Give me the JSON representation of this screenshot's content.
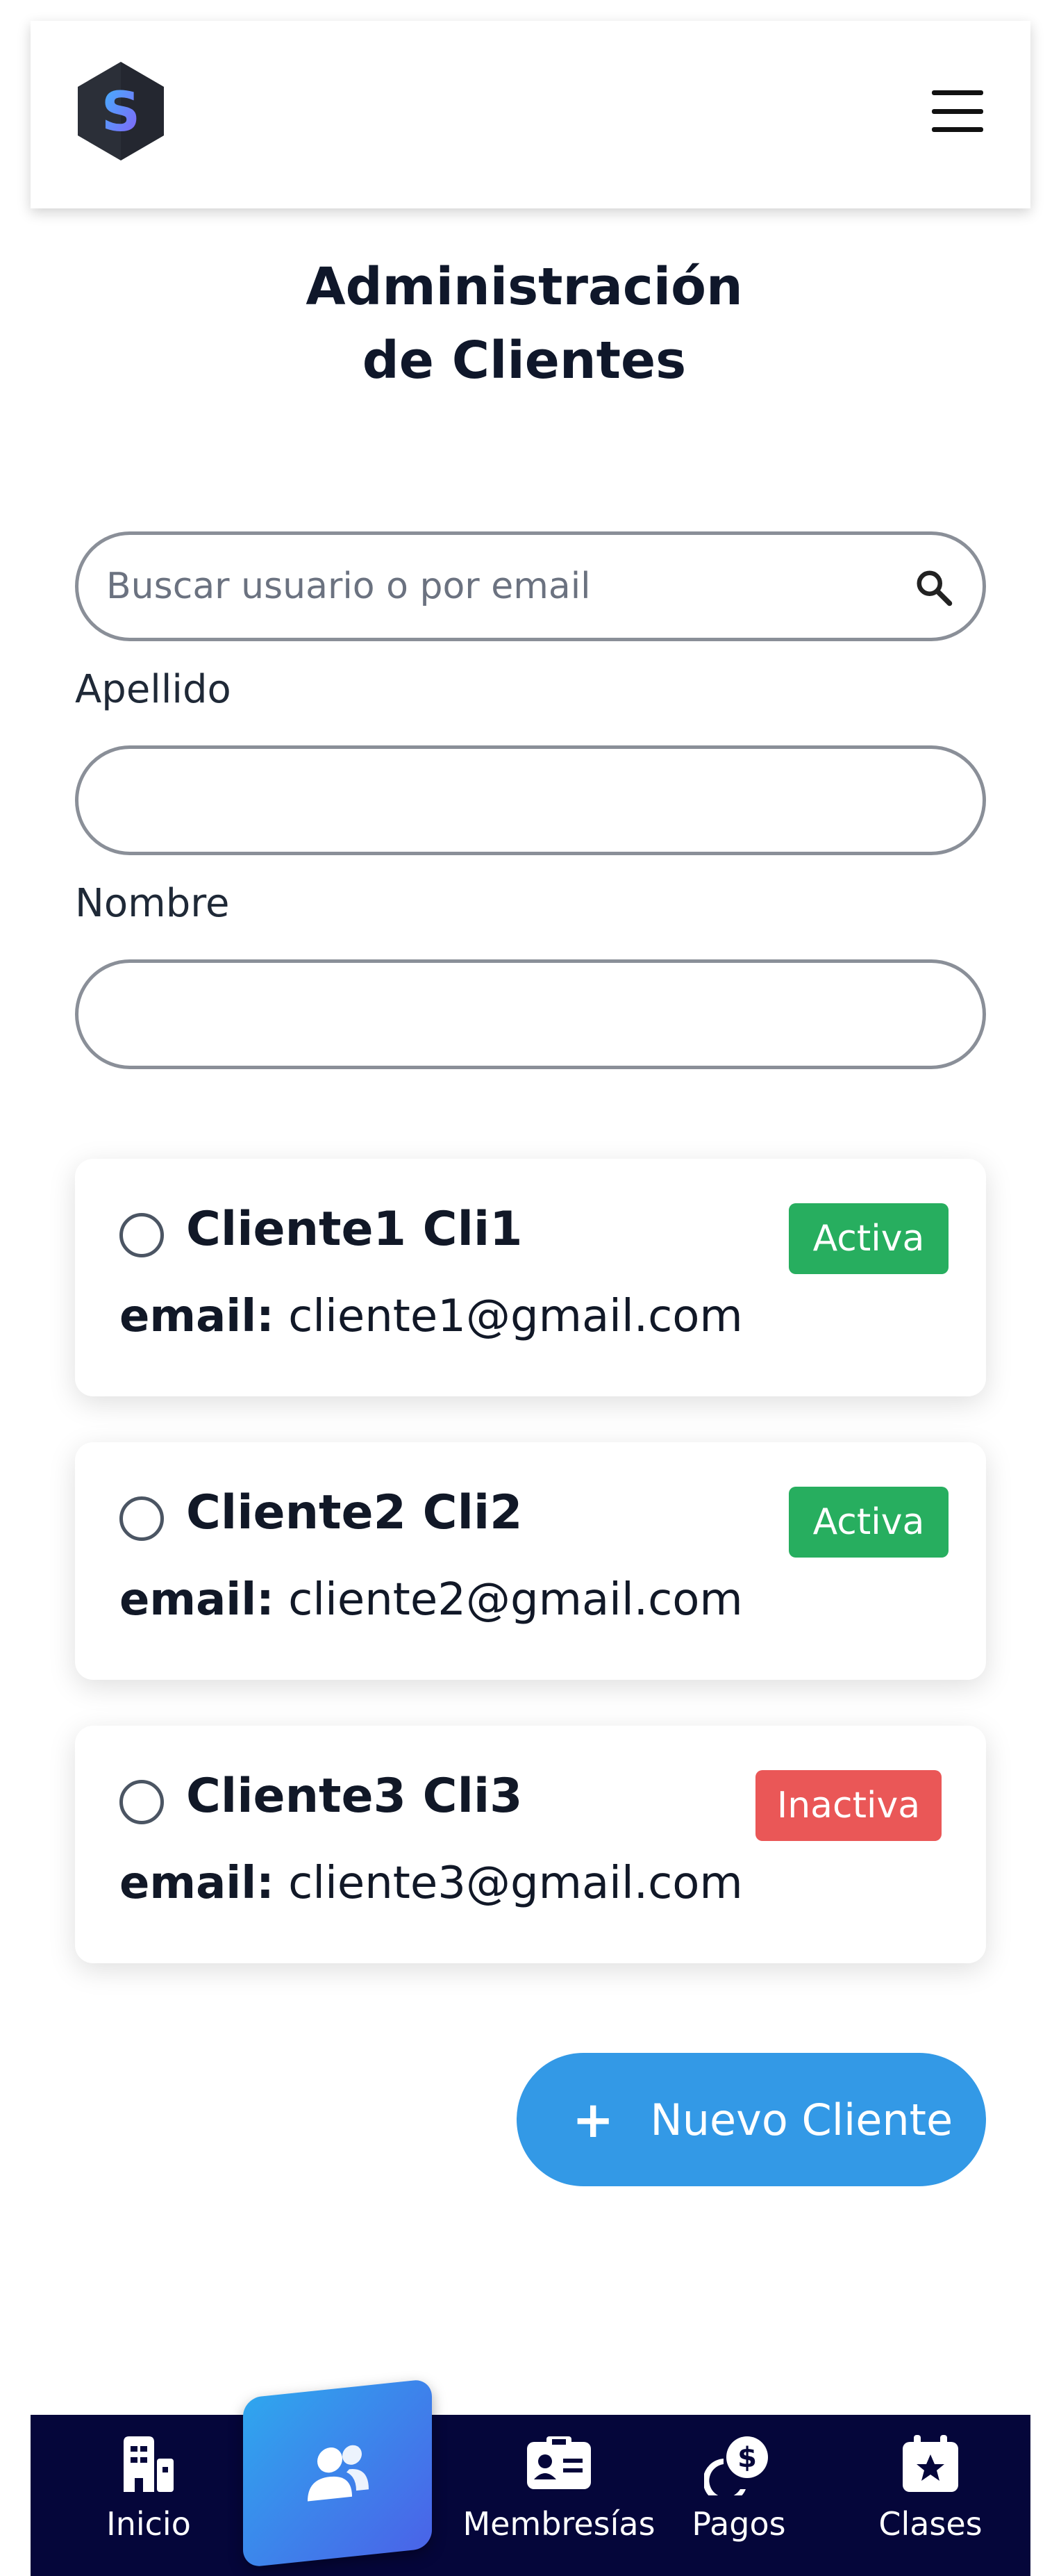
{
  "header": {
    "logo_letter": "S",
    "menu_icon": "hamburger-menu-icon"
  },
  "page": {
    "title_line1": "Administración",
    "title_line2": "de Clientes"
  },
  "search": {
    "placeholder": "Buscar usuario o por email",
    "value": "",
    "icon": "search-icon"
  },
  "filters": {
    "apellido_label": "Apellido",
    "apellido_value": "",
    "nombre_label": "Nombre",
    "nombre_value": ""
  },
  "clients": [
    {
      "name": "Cliente1 Cli1",
      "email_label": "email:",
      "email": "cliente1@gmail.com",
      "status": "Activa",
      "status_color": "#27ae5f"
    },
    {
      "name": "Cliente2 Cli2",
      "email_label": "email:",
      "email": "cliente2@gmail.com",
      "status": "Activa",
      "status_color": "#27ae5f"
    },
    {
      "name": "Cliente3 Cli3",
      "email_label": "email:",
      "email": "cliente3@gmail.com",
      "status": "Inactiva",
      "status_color": "#ea5757"
    }
  ],
  "actions": {
    "new_client_label": "Nuevo Cliente",
    "new_client_icon": "plus-icon"
  },
  "bottom_nav": {
    "items": [
      {
        "label": "Inicio",
        "icon": "building-icon"
      },
      {
        "label": "",
        "icon": "users-icon",
        "active": true
      },
      {
        "label": "Membresías",
        "icon": "id-card-icon"
      },
      {
        "label": "Pagos",
        "icon": "coins-icon"
      },
      {
        "label": "Clases",
        "icon": "calendar-star-icon"
      }
    ],
    "active_gradient": [
      "#2fa6ee",
      "#4a63e8"
    ],
    "background": "#05063a"
  },
  "colors": {
    "accent": "#3399e6",
    "active_badge": "#27ae5f",
    "inactive_badge": "#ea5757"
  }
}
